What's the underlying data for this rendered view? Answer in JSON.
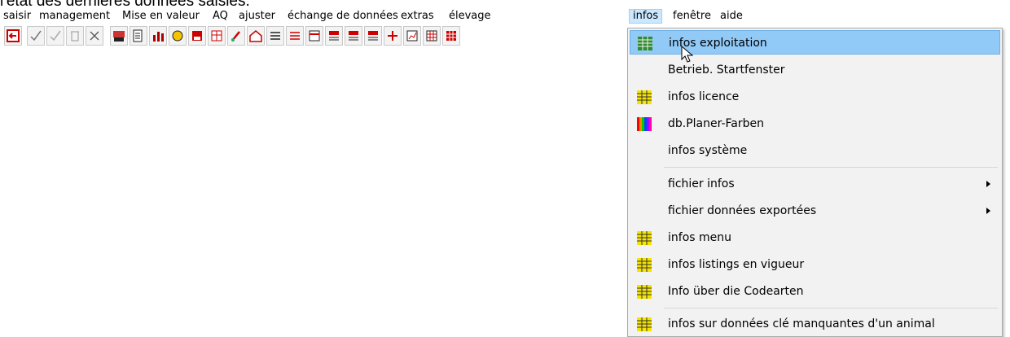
{
  "page_text": "l'état des dernières données saisies.",
  "menubar": {
    "items": [
      {
        "label": "saisir"
      },
      {
        "label": "management"
      },
      {
        "label": "Mise en valeur"
      },
      {
        "label": "AQ"
      },
      {
        "label": "ajuster"
      },
      {
        "label": "échange de données"
      },
      {
        "label": "extras"
      },
      {
        "label": "élevage"
      },
      {
        "label": "infos",
        "active": true
      },
      {
        "label": "fenêtre"
      },
      {
        "label": "aide"
      }
    ]
  },
  "toolbar": {
    "buttons": [
      "exit-icon",
      "check-icon",
      "check-disabled-icon",
      "delete-icon",
      "cross-icon",
      "animal-abc-icon",
      "printer-icon",
      "bar-chart-icon",
      "sun-icon",
      "tag-100-icon",
      "ha-table-icon",
      "brush-icon",
      "farm-house-icon",
      "list-icon",
      "list-2-icon",
      "calendar-icon",
      "cow-list-icon",
      "cow-list-2-icon",
      "cow-list-3-icon",
      "add-icon",
      "chart-icon",
      "grid-icon",
      "grid-2-icon"
    ]
  },
  "dropdown": {
    "items": [
      {
        "label": "infos exploitation",
        "icon": "info-grid-icon-green",
        "hover": true
      },
      {
        "label": "Betrieb. Startfenster",
        "icon": ""
      },
      {
        "label": "infos licence",
        "icon": "info-grid-icon-yellow"
      },
      {
        "label": "db.Planer-Farben",
        "icon": "color-bars-icon"
      },
      {
        "label": "infos système",
        "icon": ""
      },
      {
        "label": "fichier infos",
        "icon": "",
        "submenu": true
      },
      {
        "label": "fichier données exportées",
        "icon": "",
        "submenu": true
      },
      {
        "label": "infos menu",
        "icon": "info-grid-icon-yellow"
      },
      {
        "label": "infos listings en vigueur",
        "icon": "info-grid-icon-yellow"
      },
      {
        "label": "Info über die Codearten",
        "icon": "info-grid-icon-yellow"
      },
      {
        "label": "infos sur données clé manquantes d'un animal",
        "icon": "info-grid-icon-yellow"
      }
    ]
  },
  "colors": {
    "menu_active_bg": "#cce8ff",
    "item_hover_bg": "#91c9f7",
    "grid_icon_yellow": "#f5e400",
    "grid_icon_green": "#2e8b2e"
  }
}
